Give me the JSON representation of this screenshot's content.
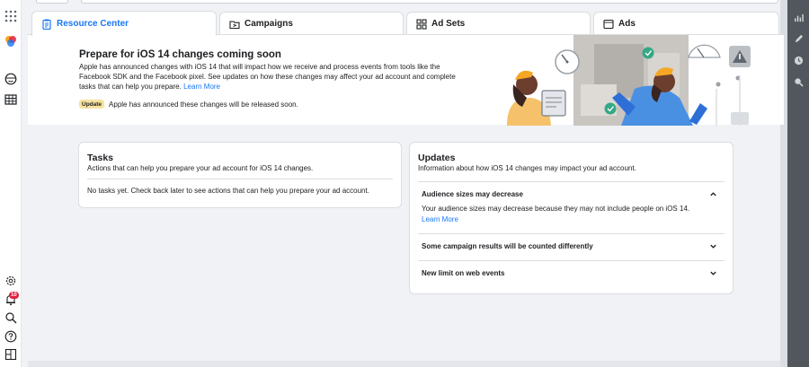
{
  "tabs": [
    {
      "label": "Resource Center",
      "icon": "clipboard-icon",
      "active": true
    },
    {
      "label": "Campaigns",
      "icon": "folder-icon",
      "active": false
    },
    {
      "label": "Ad Sets",
      "icon": "grid-icon",
      "active": false
    },
    {
      "label": "Ads",
      "icon": "ad-icon",
      "active": false
    }
  ],
  "banner": {
    "title": "Prepare for iOS 14 changes coming soon",
    "text": "Apple has announced changes with iOS 14 that will impact how we receive and process events from tools like the Facebook SDK and the Facebook pixel. See updates on how these changes may affect your ad account and complete tasks that can help you prepare.",
    "link": "Learn More",
    "badge": "Update",
    "badge_text": "Apple has announced these changes will be released soon."
  },
  "tasks": {
    "title": "Tasks",
    "subtitle": "Actions that can help you prepare your ad account for iOS 14 changes.",
    "empty": "No tasks yet. Check back later to see actions that can help you prepare your ad account."
  },
  "updates": {
    "title": "Updates",
    "subtitle": "Information about how iOS 14 changes may impact your ad account.",
    "items": [
      {
        "title": "Audience sizes may decrease",
        "body": "Your audience sizes may decrease because they may not include people on iOS 14.",
        "link": "Learn More",
        "expanded": true
      },
      {
        "title": "Some campaign results will be counted differently",
        "expanded": false
      },
      {
        "title": "New limit on web events",
        "expanded": false
      }
    ]
  },
  "leftnav": {
    "notification_count": "10",
    "icons": [
      "apps-grid-icon",
      "business-logo-icon",
      "face-icon",
      "table-icon",
      "settings-icon",
      "notifications-icon",
      "search-icon",
      "help-icon",
      "reports-icon"
    ]
  },
  "rightrail": {
    "icons": [
      "bar-chart-icon",
      "pencil-icon",
      "clock-icon",
      "zoom-icon"
    ]
  },
  "colors": {
    "accent": "#1877f2",
    "badge": "#f7e29f",
    "rail": "#52575e"
  }
}
